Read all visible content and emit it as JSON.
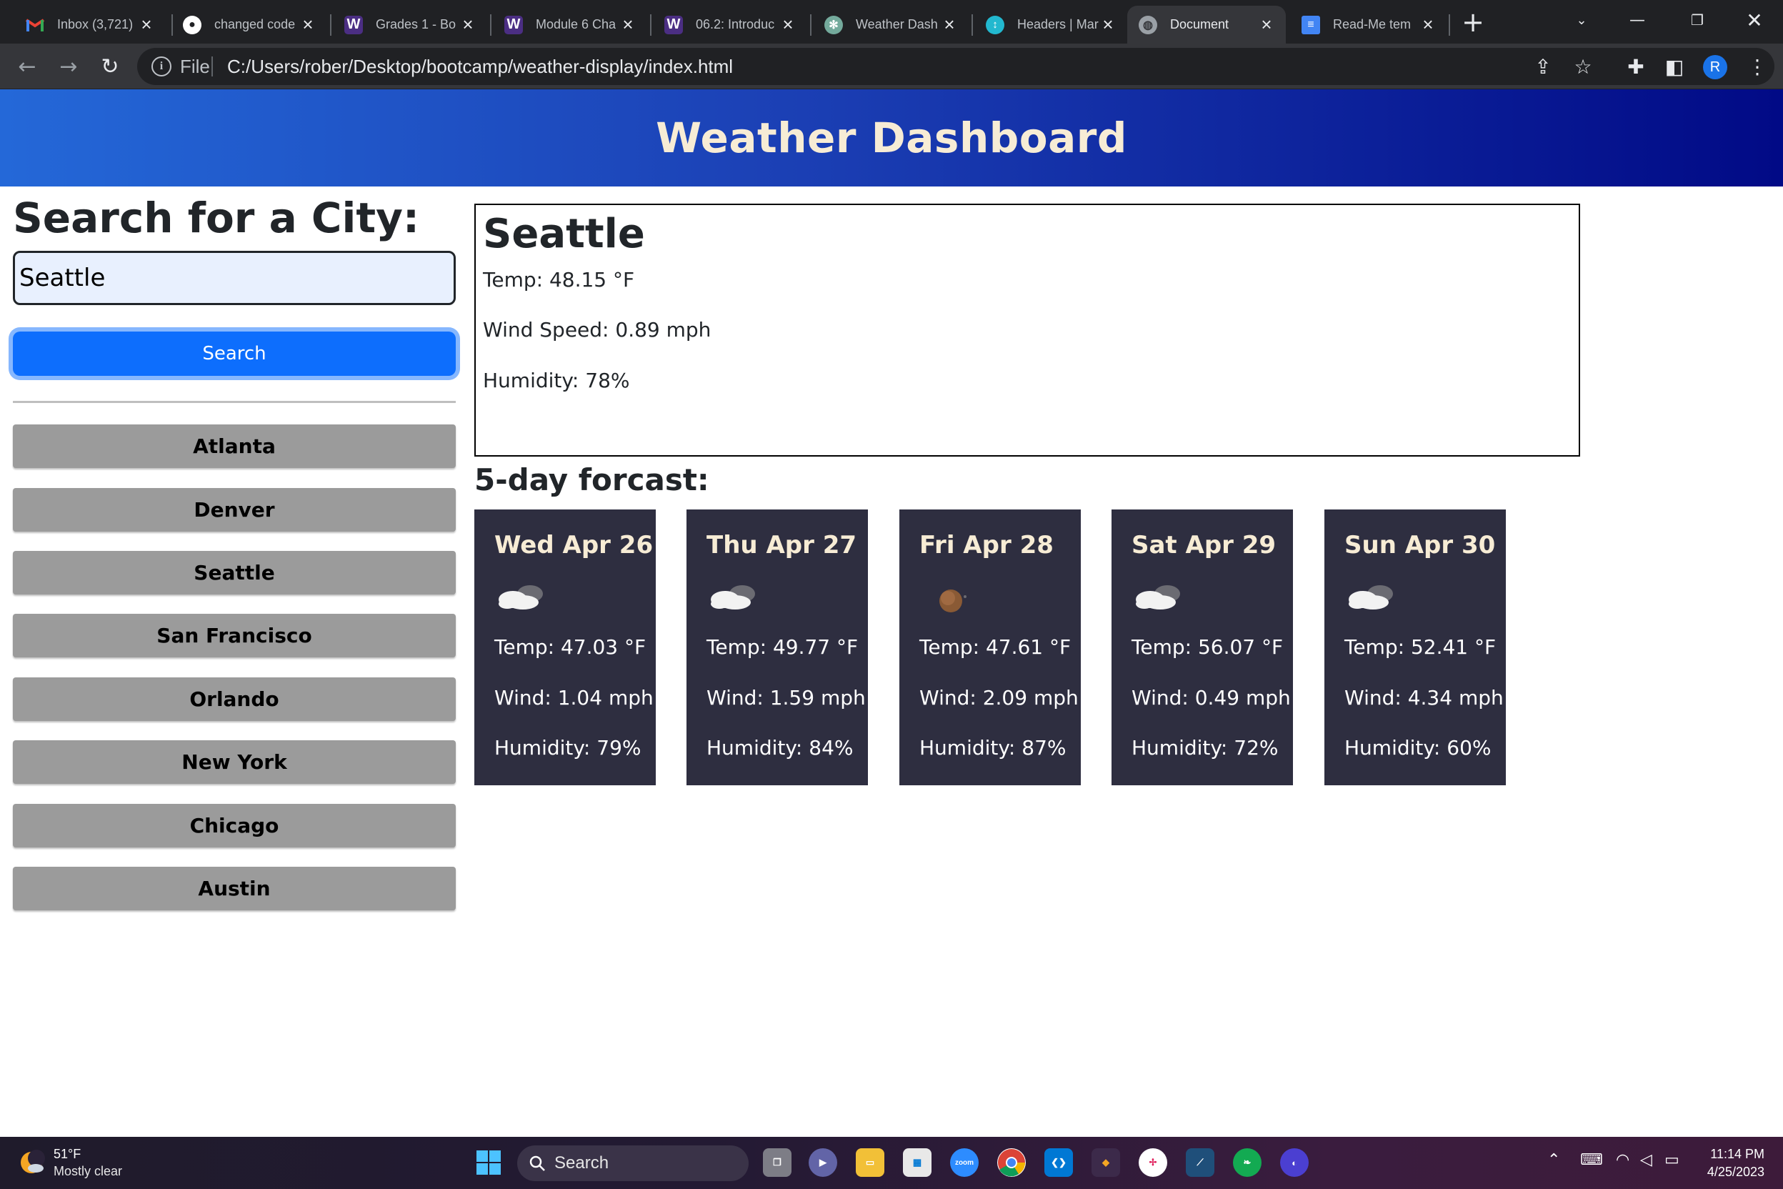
{
  "browser": {
    "tabs": [
      {
        "title": "Inbox (3,721)",
        "favicon": "gmail-icon",
        "active": false
      },
      {
        "title": "changed code",
        "favicon": "github-icon",
        "active": false
      },
      {
        "title": "Grades 1 - Bo",
        "favicon": "uw-icon",
        "active": false
      },
      {
        "title": "Module 6 Cha",
        "favicon": "uw-icon",
        "active": false
      },
      {
        "title": "06.2: Introduc",
        "favicon": "uw-icon",
        "active": false
      },
      {
        "title": "Weather Dash",
        "favicon": "chatgpt-icon",
        "active": false
      },
      {
        "title": "Headers | Mar",
        "favicon": "markdown-guide-icon",
        "active": false
      },
      {
        "title": "Document",
        "favicon": "globe-icon",
        "active": true
      },
      {
        "title": "Read-Me tem",
        "favicon": "google-docs-icon",
        "active": false
      }
    ],
    "address": {
      "scheme_label": "File",
      "url": "C:/Users/rober/Desktop/bootcamp/weather-display/index.html"
    },
    "profile_initial": "R"
  },
  "page": {
    "header_title": "Weather Dashboard",
    "search_heading": "Search for a City:",
    "search_value": "Seattle",
    "search_button": "Search",
    "history": [
      "Atlanta",
      "Denver",
      "Seattle",
      "San Francisco",
      "Orlando",
      "New York",
      "Chicago",
      "Austin"
    ],
    "current": {
      "city": "Seattle",
      "temp": "Temp: 48.15 °F",
      "wind": "Wind Speed: 0.89 mph",
      "humidity": "Humidity: 78%"
    },
    "forecast_heading": "5-day forcast:",
    "forecast": [
      {
        "date": "Wed Apr 26",
        "icon": "partly-cloudy-icon",
        "temp": "Temp: 47.03 °F",
        "wind": "Wind: 1.04 mph",
        "humidity": "Humidity: 79%"
      },
      {
        "date": "Thu Apr 27",
        "icon": "partly-cloudy-icon",
        "temp": "Temp: 49.77 °F",
        "wind": "Wind: 1.59 mph",
        "humidity": "Humidity: 84%"
      },
      {
        "date": "Fri Apr 28",
        "icon": "moon-icon",
        "temp": "Temp: 47.61 °F",
        "wind": "Wind: 2.09 mph",
        "humidity": "Humidity: 87%"
      },
      {
        "date": "Sat Apr 29",
        "icon": "partly-cloudy-icon",
        "temp": "Temp: 56.07 °F",
        "wind": "Wind: 0.49 mph",
        "humidity": "Humidity: 72%"
      },
      {
        "date": "Sun Apr 30",
        "icon": "partly-cloudy-icon",
        "temp": "Temp: 52.41 °F",
        "wind": "Wind: 4.34 mph",
        "humidity": "Humidity: 60%"
      }
    ]
  },
  "taskbar": {
    "weather_temp": "51°F",
    "weather_desc": "Mostly clear",
    "search_label": "Search",
    "time": "11:14 PM",
    "date": "4/25/2023"
  },
  "colors": {
    "header_gradient_start": "#2468d8",
    "header_gradient_end": "#010a86",
    "header_text": "#f7ecd5",
    "search_button": "#0d6efd",
    "history_button": "#9b9b9b",
    "forecast_card": "#2e2e40"
  }
}
